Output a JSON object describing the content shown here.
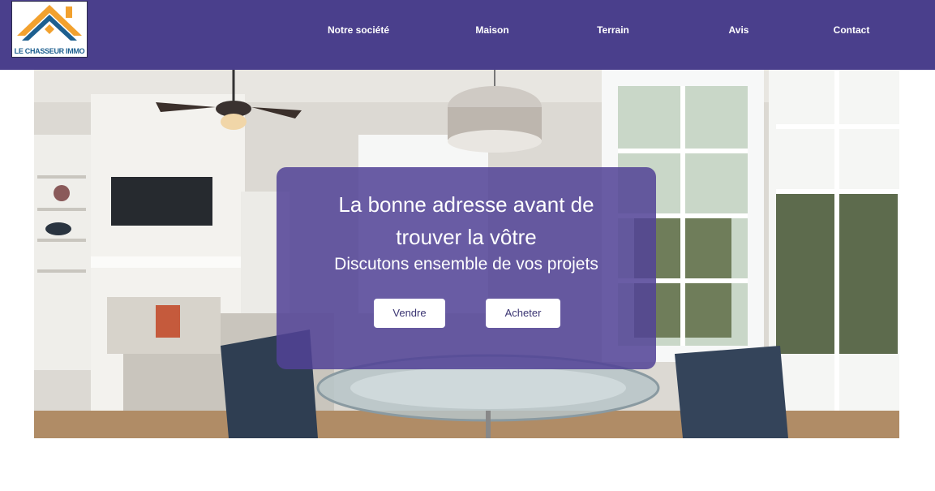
{
  "logo": {
    "text": "LE CHASSEUR IMMO"
  },
  "nav": {
    "items": [
      {
        "label": "Notre société"
      },
      {
        "label": "Maison"
      },
      {
        "label": "Terrain"
      },
      {
        "label": "Avis"
      },
      {
        "label": "Contact"
      }
    ]
  },
  "hero": {
    "title": "La bonne adresse avant de trouver la vôtre",
    "subtitle": "Discutons ensemble de vos projets",
    "sell_label": "Vendre",
    "buy_label": "Acheter"
  },
  "colors": {
    "navbar": "#4a3f8c",
    "overlay": "#524296",
    "button_text": "#3a3472",
    "logo_orange": "#f2a12e",
    "logo_blue": "#1d5f8f"
  }
}
